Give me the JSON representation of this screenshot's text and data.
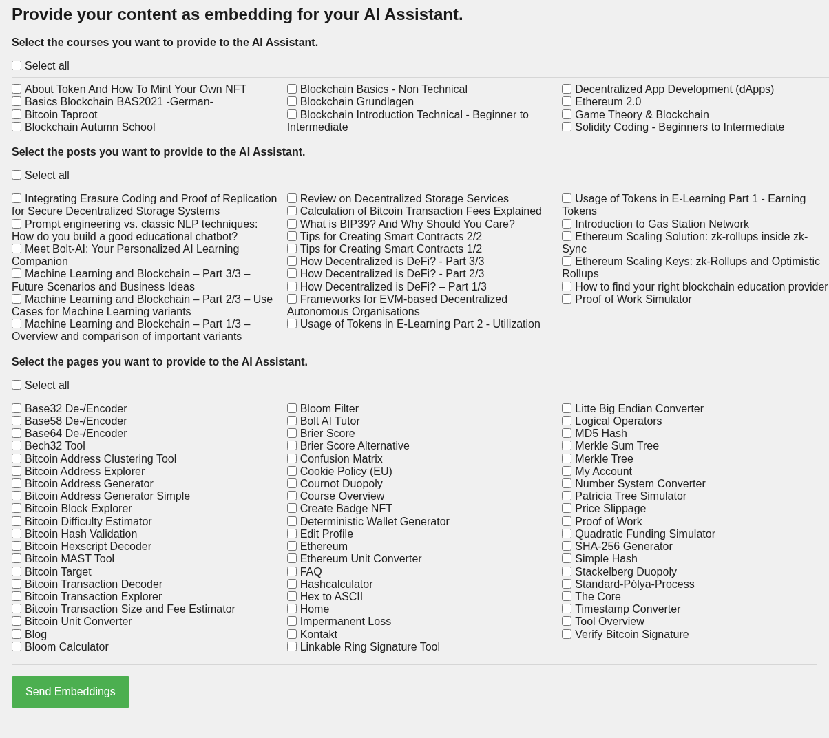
{
  "title": "Provide your content as embedding for your AI Assistant.",
  "sections": [
    {
      "heading": "Select the courses you want to provide to the AI Assistant.",
      "select_all": {
        "label": "Select all",
        "checked": false
      },
      "items": [
        {
          "label": "About Token And How To Mint Your Own NFT",
          "checked": false
        },
        {
          "label": "Basics Blockchain BAS2021 -German-",
          "checked": false
        },
        {
          "label": "Bitcoin Taproot",
          "checked": false
        },
        {
          "label": "Blockchain Autumn School",
          "checked": false
        },
        {
          "label": "Blockchain Basics - Non Technical",
          "checked": false
        },
        {
          "label": "Blockchain Grundlagen",
          "checked": false
        },
        {
          "label": "Blockchain Introduction Technical - Beginner to Intermediate",
          "checked": false
        },
        {
          "label": "Decentralized App Development (dApps)",
          "checked": false
        },
        {
          "label": "Ethereum 2.0",
          "checked": false
        },
        {
          "label": "Game Theory & Blockchain",
          "checked": false
        },
        {
          "label": "Solidity Coding - Beginners to Intermediate",
          "checked": false
        }
      ]
    },
    {
      "heading": "Select the posts you want to provide to the AI Assistant.",
      "select_all": {
        "label": "Select all",
        "checked": false
      },
      "items": [
        {
          "label": "Integrating Erasure Coding and Proof of Replication for Secure Decentralized Storage Systems",
          "checked": false
        },
        {
          "label": "Prompt engineering vs. classic NLP techniques: How do you build a good educational chatbot?",
          "checked": false
        },
        {
          "label": "Meet Bolt-AI: Your Personalized AI Learning Companion",
          "checked": false
        },
        {
          "label": "Machine Learning and Blockchain – Part 3/3 – Future Scenarios and Business Ideas",
          "checked": false
        },
        {
          "label": "Machine Learning and Blockchain – Part 2/3 – Use Cases for Machine Learning variants",
          "checked": false
        },
        {
          "label": "Machine Learning and Blockchain – Part 1/3 – Overview and comparison of important variants",
          "checked": false
        },
        {
          "label": "Review on Decentralized Storage Services",
          "checked": false
        },
        {
          "label": "Calculation of Bitcoin Transaction Fees Explained",
          "checked": false
        },
        {
          "label": "What is BIP39? And Why Should You Care?",
          "checked": false
        },
        {
          "label": "Tips for Creating Smart Contracts 2/2",
          "checked": false
        },
        {
          "label": "Tips for Creating Smart Contracts 1/2",
          "checked": false
        },
        {
          "label": "How Decentralized is DeFi? - Part 3/3",
          "checked": false
        },
        {
          "label": "How Decentralized is DeFi? - Part 2/3",
          "checked": false
        },
        {
          "label": "How Decentralized is DeFi? – Part 1/3",
          "checked": false
        },
        {
          "label": "Frameworks for EVM-based Decentralized Autonomous Organisations",
          "checked": false
        },
        {
          "label": "Usage of Tokens in E-Learning Part 2 - Utilization",
          "checked": false
        },
        {
          "label": "Usage of Tokens in E-Learning Part 1 - Earning Tokens",
          "checked": false
        },
        {
          "label": "Introduction to Gas Station Network",
          "checked": false
        },
        {
          "label": "Ethereum Scaling Solution: zk-rollups inside zk-Sync",
          "checked": false
        },
        {
          "label": "Ethereum Scaling Keys: zk-Rollups and Optimistic Rollups",
          "checked": false
        },
        {
          "label": "How to find your right blockchain education provider",
          "checked": false
        },
        {
          "label": "Proof of Work Simulator",
          "checked": false
        }
      ]
    },
    {
      "heading": "Select the pages you want to provide to the AI Assistant.",
      "select_all": {
        "label": "Select all",
        "checked": false
      },
      "items": [
        {
          "label": "Base32 De-/Encoder",
          "checked": false
        },
        {
          "label": "Base58 De-/Encoder",
          "checked": false
        },
        {
          "label": "Base64 De-/Encoder",
          "checked": false
        },
        {
          "label": "Bech32 Tool",
          "checked": false
        },
        {
          "label": "Bitcoin Address Clustering Tool",
          "checked": false
        },
        {
          "label": "Bitcoin Address Explorer",
          "checked": false
        },
        {
          "label": "Bitcoin Address Generator",
          "checked": false
        },
        {
          "label": "Bitcoin Address Generator Simple",
          "checked": false
        },
        {
          "label": "Bitcoin Block Explorer",
          "checked": false
        },
        {
          "label": "Bitcoin Difficulty Estimator",
          "checked": false
        },
        {
          "label": "Bitcoin Hash Validation",
          "checked": false
        },
        {
          "label": "Bitcoin Hexscript Decoder",
          "checked": false
        },
        {
          "label": "Bitcoin MAST Tool",
          "checked": false
        },
        {
          "label": "Bitcoin Target",
          "checked": false
        },
        {
          "label": "Bitcoin Transaction Decoder",
          "checked": false
        },
        {
          "label": "Bitcoin Transaction Explorer",
          "checked": false
        },
        {
          "label": "Bitcoin Transaction Size and Fee Estimator",
          "checked": false
        },
        {
          "label": "Bitcoin Unit Converter",
          "checked": false
        },
        {
          "label": "Blog",
          "checked": false
        },
        {
          "label": "Bloom Calculator",
          "checked": false
        },
        {
          "label": "Bloom Filter",
          "checked": false
        },
        {
          "label": "Bolt AI Tutor",
          "checked": false
        },
        {
          "label": "Brier Score",
          "checked": false
        },
        {
          "label": "Brier Score Alternative",
          "checked": false
        },
        {
          "label": "Confusion Matrix",
          "checked": false
        },
        {
          "label": "Cookie Policy (EU)",
          "checked": false
        },
        {
          "label": "Cournot Duopoly",
          "checked": false
        },
        {
          "label": "Course Overview",
          "checked": false
        },
        {
          "label": "Create Badge NFT",
          "checked": false
        },
        {
          "label": "Deterministic Wallet Generator",
          "checked": false
        },
        {
          "label": "Edit Profile",
          "checked": false
        },
        {
          "label": "Ethereum",
          "checked": false
        },
        {
          "label": "Ethereum Unit Converter",
          "checked": false
        },
        {
          "label": "FAQ",
          "checked": false
        },
        {
          "label": "Hashcalculator",
          "checked": false
        },
        {
          "label": "Hex to ASCII",
          "checked": false
        },
        {
          "label": "Home",
          "checked": false
        },
        {
          "label": "Impermanent Loss",
          "checked": false
        },
        {
          "label": "Kontakt",
          "checked": false
        },
        {
          "label": "Linkable Ring Signature Tool",
          "checked": false
        },
        {
          "label": "Litte Big Endian Converter",
          "checked": false
        },
        {
          "label": "Logical Operators",
          "checked": false
        },
        {
          "label": "MD5 Hash",
          "checked": false
        },
        {
          "label": "Merkle Sum Tree",
          "checked": false
        },
        {
          "label": "Merkle Tree",
          "checked": false
        },
        {
          "label": "My Account",
          "checked": false
        },
        {
          "label": "Number System Converter",
          "checked": false
        },
        {
          "label": "Patricia Tree Simulator",
          "checked": false
        },
        {
          "label": "Price Slippage",
          "checked": false
        },
        {
          "label": "Proof of Work",
          "checked": false
        },
        {
          "label": "Quadratic Funding Simulator",
          "checked": false
        },
        {
          "label": "SHA-256 Generator",
          "checked": false
        },
        {
          "label": "Simple Hash",
          "checked": false
        },
        {
          "label": "Stackelberg Duopoly",
          "checked": false
        },
        {
          "label": "Standard-Pólya-Process",
          "checked": false
        },
        {
          "label": "The Core",
          "checked": false
        },
        {
          "label": "Timestamp Converter",
          "checked": false
        },
        {
          "label": "Tool Overview",
          "checked": false
        },
        {
          "label": "Verify Bitcoin Signature",
          "checked": false
        }
      ]
    }
  ],
  "submit": {
    "label": "Send Embeddings"
  }
}
